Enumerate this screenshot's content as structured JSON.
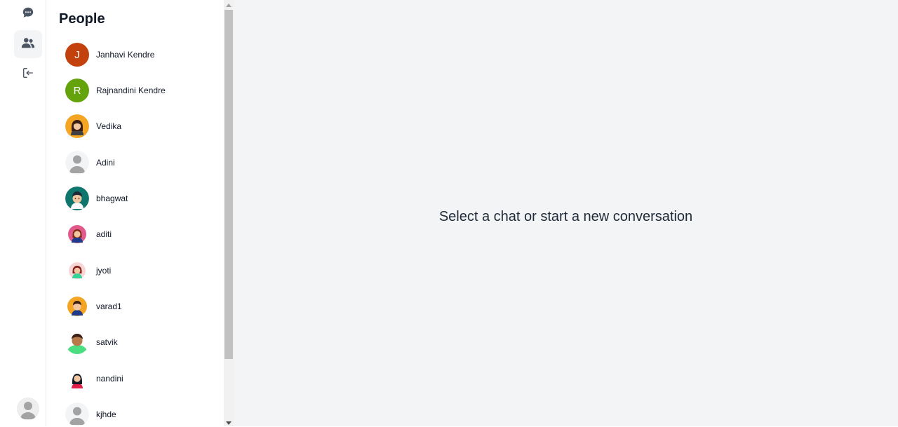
{
  "rail": {
    "items": [
      {
        "icon": "chat-bubble-icon"
      },
      {
        "icon": "people-icon",
        "active": true
      },
      {
        "icon": "logout-icon"
      }
    ],
    "profile_avatar": "default-user-avatar"
  },
  "people": {
    "title": "People",
    "contacts": [
      {
        "name": "Janhavi Kendre",
        "initial": "J",
        "color": "#c2410c"
      },
      {
        "name": "Rajnandini Kendre",
        "initial": "R",
        "color": "#65a30d"
      },
      {
        "name": "Vedika"
      },
      {
        "name": "Adini"
      },
      {
        "name": "bhagwat"
      },
      {
        "name": "aditi"
      },
      {
        "name": "jyoti"
      },
      {
        "name": "varad1"
      },
      {
        "name": "satvik"
      },
      {
        "name": "nandini"
      },
      {
        "name": "kjhde"
      }
    ]
  },
  "main": {
    "empty_message": "Select a chat or start a new conversation"
  },
  "colors": {
    "rail_bg": "#ffffff",
    "main_bg": "#f3f4f6",
    "active_bg": "#f3f4f6"
  }
}
